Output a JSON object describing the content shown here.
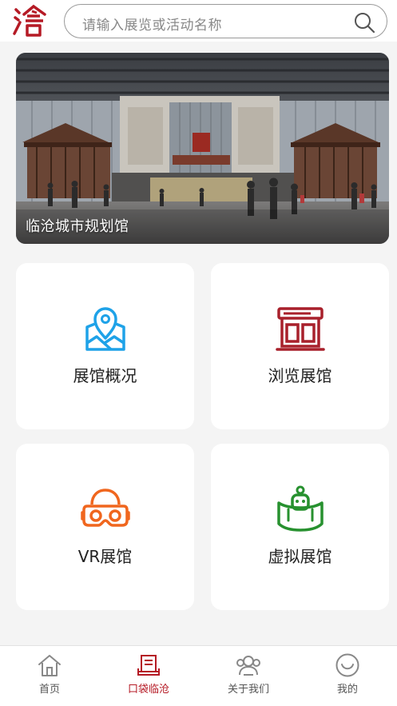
{
  "header": {
    "logo": "city-seal-logo",
    "search_placeholder": "请输入展览或活动名称",
    "search_icon": "search-icon"
  },
  "banner": {
    "caption": "临沧城市规划馆"
  },
  "cards": [
    {
      "label": "展馆概况",
      "icon": "map-pin-icon",
      "color": "#1ea2e8"
    },
    {
      "label": "浏览展馆",
      "icon": "storefront-icon",
      "color": "#a8202b"
    },
    {
      "label": "VR展馆",
      "icon": "vr-headset-icon",
      "color": "#f0661e"
    },
    {
      "label": "虚拟展馆",
      "icon": "virtual-robot-icon",
      "color": "#27912f"
    }
  ],
  "tabbar": {
    "items": [
      {
        "label": "首页",
        "icon": "home-icon",
        "active": false
      },
      {
        "label": "口袋临沧",
        "icon": "book-icon",
        "active": true
      },
      {
        "label": "关于我们",
        "icon": "users-icon",
        "active": false
      },
      {
        "label": "我的",
        "icon": "smile-icon",
        "active": false
      }
    ],
    "active_color": "#b51a25",
    "inactive_color": "#555555"
  }
}
